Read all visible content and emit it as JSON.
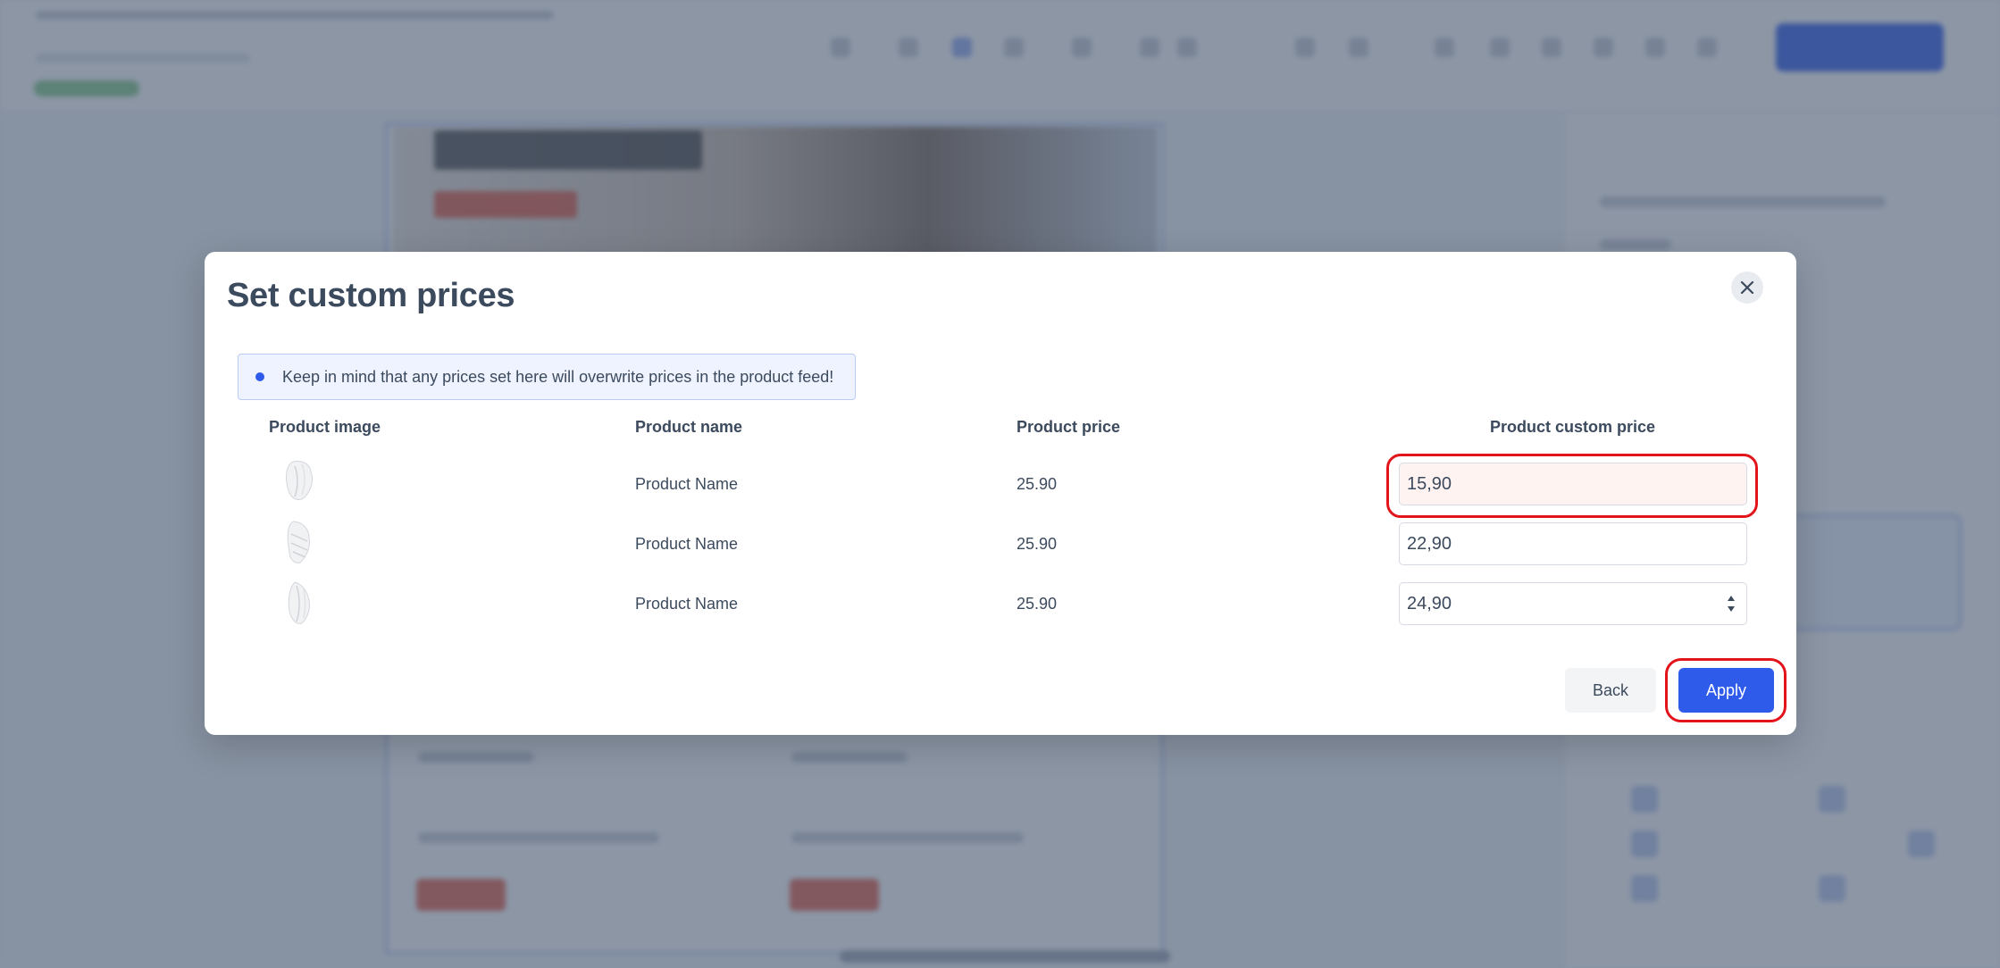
{
  "modal": {
    "title": "Set custom prices",
    "notice": "Keep in mind that any prices set here will overwrite prices in the product feed!",
    "columns": {
      "image": "Product image",
      "name": "Product name",
      "price": "Product price",
      "custom_price": "Product custom price"
    },
    "rows": [
      {
        "name": "Product Name",
        "price": "25.90",
        "custom_price": "15,90"
      },
      {
        "name": "Product Name",
        "price": "25.90",
        "custom_price": "22,90"
      },
      {
        "name": "Product Name",
        "price": "25.90",
        "custom_price": "24,90"
      }
    ],
    "back_label": "Back",
    "apply_label": "Apply"
  },
  "icons": {
    "close": "close-icon",
    "notice": "info-dot-icon",
    "spinner": "number-spinner-icon"
  },
  "colors": {
    "accent": "#2f5bea",
    "highlight": "#e3141b",
    "title": "#3c4a5e",
    "info_bg": "#eef3ff"
  }
}
